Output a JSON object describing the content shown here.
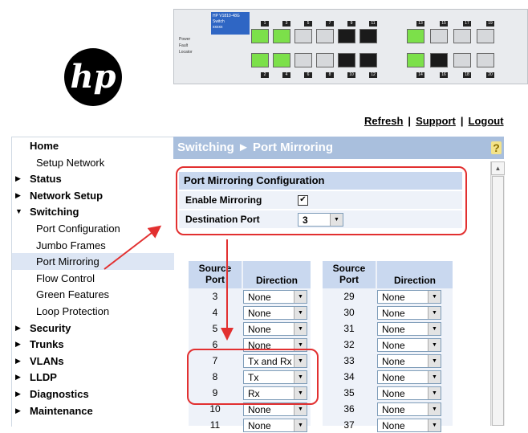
{
  "logo": {
    "text": "hp"
  },
  "switch_panel": {
    "model_lines": [
      "HP V1810-48G",
      "Switch",
      "xxxxx"
    ],
    "legend_left": [
      "Power",
      "Fault",
      "Locator"
    ],
    "ports_top": [
      {
        "num": "1",
        "state": "g"
      },
      {
        "num": "3",
        "state": "g"
      },
      {
        "num": "5",
        "state": "e"
      },
      {
        "num": "7",
        "state": "e"
      },
      {
        "num": "9",
        "state": "k"
      },
      {
        "num": "11",
        "state": "k"
      },
      {
        "num": "13",
        "state": "g"
      },
      {
        "num": "15",
        "state": "e"
      },
      {
        "num": "17",
        "state": "e"
      },
      {
        "num": "19",
        "state": "e"
      }
    ],
    "ports_bottom": [
      {
        "num": "2",
        "state": "g"
      },
      {
        "num": "4",
        "state": "g"
      },
      {
        "num": "6",
        "state": "e"
      },
      {
        "num": "8",
        "state": "e"
      },
      {
        "num": "10",
        "state": "k"
      },
      {
        "num": "12",
        "state": "k"
      },
      {
        "num": "14",
        "state": "g"
      },
      {
        "num": "16",
        "state": "k"
      },
      {
        "num": "18",
        "state": "e"
      },
      {
        "num": "20",
        "state": "e"
      }
    ]
  },
  "top_links": [
    {
      "label": "Refresh"
    },
    {
      "label": "Support"
    },
    {
      "label": "Logout"
    }
  ],
  "sidebar": {
    "items": [
      {
        "label": "Home",
        "level": "top",
        "arrow": ""
      },
      {
        "label": "Setup Network",
        "level": "sub",
        "arrow": ""
      },
      {
        "label": "Status",
        "level": "top",
        "arrow": "▶"
      },
      {
        "label": "Network Setup",
        "level": "top",
        "arrow": "▶"
      },
      {
        "label": "Switching",
        "level": "top",
        "arrow": "▼"
      },
      {
        "label": "Port Configuration",
        "level": "sub",
        "arrow": ""
      },
      {
        "label": "Jumbo Frames",
        "level": "sub",
        "arrow": ""
      },
      {
        "label": "Port Mirroring",
        "level": "sub",
        "arrow": "",
        "active": true
      },
      {
        "label": "Flow Control",
        "level": "sub",
        "arrow": ""
      },
      {
        "label": "Green Features",
        "level": "sub",
        "arrow": ""
      },
      {
        "label": "Loop Protection",
        "level": "sub",
        "arrow": ""
      },
      {
        "label": "Security",
        "level": "top",
        "arrow": "▶"
      },
      {
        "label": "Trunks",
        "level": "top",
        "arrow": "▶"
      },
      {
        "label": "VLANs",
        "level": "top",
        "arrow": "▶"
      },
      {
        "label": "LLDP",
        "level": "top",
        "arrow": "▶"
      },
      {
        "label": "Diagnostics",
        "level": "top",
        "arrow": "▶"
      },
      {
        "label": "Maintenance",
        "level": "top",
        "arrow": "▶"
      }
    ]
  },
  "main": {
    "breadcrumb": "Switching ► Port Mirroring",
    "help_icon": "?",
    "config": {
      "heading": "Port Mirroring Configuration",
      "enable_label": "Enable Mirroring",
      "enable_checked": "✔",
      "dest_label": "Destination Port",
      "dest_value": "3"
    },
    "table_headers": {
      "source_port": "Source Port",
      "direction": "Direction"
    },
    "left_rows": [
      {
        "port": "3",
        "dir": "None"
      },
      {
        "port": "4",
        "dir": "None"
      },
      {
        "port": "5",
        "dir": "None"
      },
      {
        "port": "6",
        "dir": "None"
      },
      {
        "port": "7",
        "dir": "Tx and Rx"
      },
      {
        "port": "8",
        "dir": "Tx"
      },
      {
        "port": "9",
        "dir": "Rx"
      },
      {
        "port": "10",
        "dir": "None"
      },
      {
        "port": "11",
        "dir": "None"
      }
    ],
    "right_rows": [
      {
        "port": "29",
        "dir": "None"
      },
      {
        "port": "30",
        "dir": "None"
      },
      {
        "port": "31",
        "dir": "None"
      },
      {
        "port": "32",
        "dir": "None"
      },
      {
        "port": "33",
        "dir": "None"
      },
      {
        "port": "34",
        "dir": "None"
      },
      {
        "port": "35",
        "dir": "None"
      },
      {
        "port": "36",
        "dir": "None"
      },
      {
        "port": "37",
        "dir": "None"
      }
    ]
  },
  "colors": {
    "annotation_red": "#e23030",
    "header_blue": "#a9bfdd"
  }
}
